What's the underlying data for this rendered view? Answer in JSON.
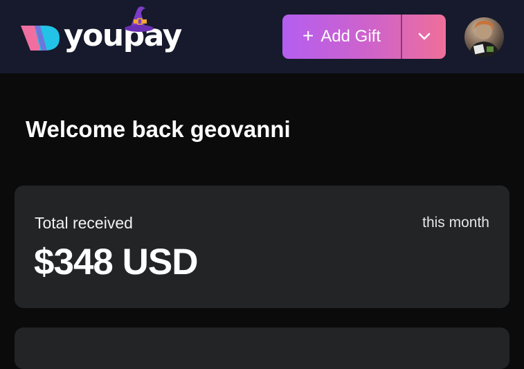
{
  "brand": {
    "name": "youpay"
  },
  "header": {
    "add_gift_label": "Add Gift",
    "add_gift_icon": "plus-icon",
    "dropdown_icon": "chevron-down-icon",
    "avatar_icon": "user-avatar"
  },
  "main": {
    "welcome_text": "Welcome back geovanni",
    "summary_card": {
      "title": "Total received",
      "period": "this month",
      "amount": "$348 USD"
    }
  },
  "colors": {
    "header_bg": "#161a2c",
    "page_bg": "#0b0b0c",
    "card_bg": "#222426",
    "button_gradient_start": "#b45ef0",
    "button_gradient_end": "#ef6f9a",
    "logo_pink": "#f06fa0",
    "logo_cyan": "#22c3e6"
  }
}
